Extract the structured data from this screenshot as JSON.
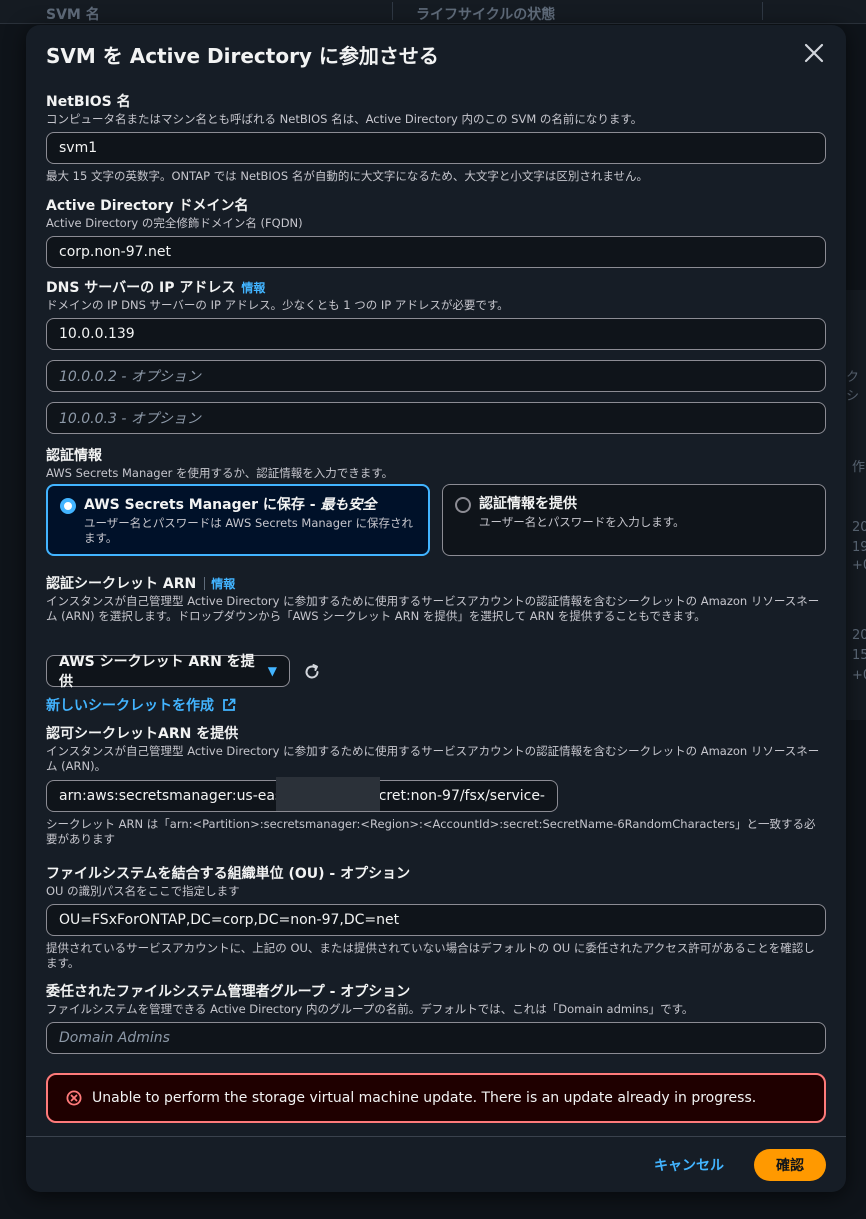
{
  "background": {
    "col1": "SVM 名",
    "col2": "ライフサイクルの状態",
    "side_texts": [
      "クシ",
      "作",
      "20",
      "19",
      "+0",
      "20",
      "15",
      "+0"
    ]
  },
  "modal": {
    "title": "SVM を Active Directory に参加させる"
  },
  "netbios": {
    "label": "NetBIOS 名",
    "description": "コンピュータ名またはマシン名とも呼ばれる NetBIOS 名は、Active Directory 内のこの SVM の名前になります。",
    "value": "svm1",
    "hint": "最大 15 文字の英数字。ONTAP では NetBIOS 名が自動的に大文字になるため、大文字と小文字は区別されません。"
  },
  "domain": {
    "label": "Active Directory ドメイン名",
    "description": "Active Directory の完全修飾ドメイン名 (FQDN)",
    "value": "corp.non-97.net"
  },
  "dns": {
    "label": "DNS サーバーの IP アドレス",
    "info": "情報",
    "description": "ドメインの IP DNS サーバーの IP アドレス。少なくとも 1 つの IP アドレスが必要です。",
    "value1": "10.0.0.139",
    "placeholder2": "10.0.0.2 - オプション",
    "placeholder3": "10.0.0.3 - オプション"
  },
  "credentials": {
    "label": "認証情報",
    "description": "AWS Secrets Manager を使用するか、認証情報を入力できます。",
    "option1_title": "AWS Secrets Manager に保存 - ",
    "option1_emph": "最も安全",
    "option1_desc": "ユーザー名とパスワードは AWS Secrets Manager に保存されます。",
    "option2_title": "認証情報を提供",
    "option2_desc": "ユーザー名とパスワードを入力します。"
  },
  "secret_arn": {
    "label": "認証シークレット ARN",
    "info": "情報",
    "description": "インスタンスが自己管理型 Active Directory に参加するために使用するサービスアカウントの認証情報を含むシークレットの Amazon リソースネーム (ARN) を選択します。ドロップダウンから「AWS シークレット ARN を提供」を選択して ARN を提供することもできます。",
    "select_value": "AWS シークレット ARN を提供",
    "create_link": "新しいシークレットを作成"
  },
  "auth_arn": {
    "label": "認可シークレットARN を提供",
    "description": "インスタンスが自己管理型 Active Directory に参加するために使用するサービスアカウントの認証情報を含むシークレットの Amazon リソースネーム (ARN)。",
    "value_prefix": "arn:aws:secretsmanager:us-east-1",
    "value_suffix": ":secret:non-97/fsx/service-",
    "hint": "シークレット ARN は「arn:<Partition>:secretsmanager:<Region>:<AccountId>:secret:SecretName-6RandomCharacters」と一致する必要があります"
  },
  "ou": {
    "label": "ファイルシステムを結合する組織単位 (OU) - オプション",
    "description": "OU の識別パス名をここで指定します",
    "value": "OU=FSxForONTAP,DC=corp,DC=non-97,DC=net",
    "hint": "提供されているサービスアカウントに、上記の OU、または提供されていない場合はデフォルトの OU に委任されたアクセス許可があることを確認します。"
  },
  "admin_group": {
    "label": "委任されたファイルシステム管理者グループ - オプション",
    "description": "ファイルシステムを管理できる Active Directory 内のグループの名前。デフォルトでは、これは「Domain admins」です。",
    "placeholder": "Domain Admins"
  },
  "error": {
    "message": "Unable to perform the storage virtual machine update. There is an update already in progress."
  },
  "footer": {
    "cancel": "キャンセル",
    "confirm": "確認"
  },
  "colors": {
    "accent": "#42b4ff",
    "primary_button": "#ff9900",
    "error_border": "#ff7a7a"
  }
}
